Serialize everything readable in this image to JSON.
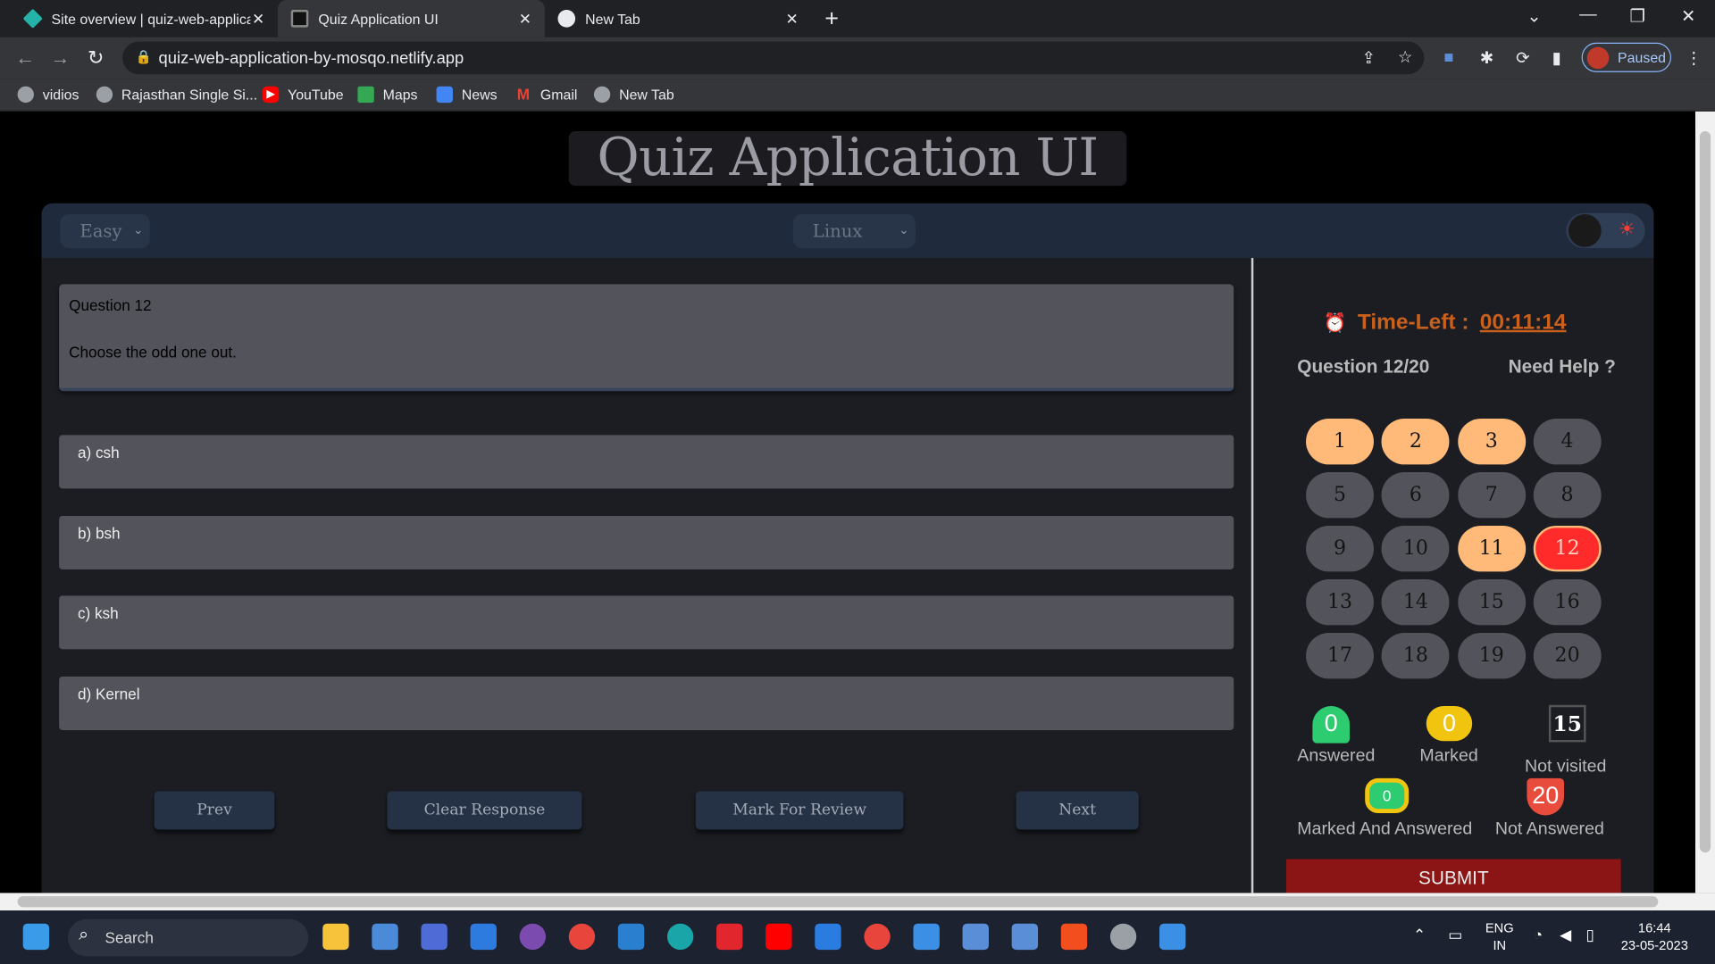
{
  "browser": {
    "tabs": [
      {
        "title": "Site overview | quiz-web-applicat",
        "active": false
      },
      {
        "title": "Quiz Application UI",
        "active": true
      },
      {
        "title": "New Tab",
        "active": false
      }
    ],
    "url": "quiz-web-application-by-mosqo.netlify.app",
    "profile_status": "Paused",
    "bookmarks": [
      "vidios",
      "Rajasthan Single Si...",
      "YouTube",
      "Maps",
      "News",
      "Gmail",
      "New Tab"
    ]
  },
  "quiz": {
    "title": "Quiz Application UI",
    "difficulty": "Easy",
    "category": "Linux",
    "question_label": "Question 12",
    "question_text": "Choose the odd one out.",
    "options": [
      "a) csh",
      "b) bsh",
      "c) ksh",
      "d) Kernel"
    ],
    "buttons": {
      "prev": "Prev",
      "clear": "Clear Response",
      "mark": "Mark For Review",
      "next": "Next"
    }
  },
  "sidebar": {
    "time_left_label": "Time-Left :",
    "time_left_value": "00:11:14",
    "question_progress": "Question 12/20",
    "help_label": "Need Help ?",
    "question_numbers": [
      "1",
      "2",
      "3",
      "4",
      "5",
      "6",
      "7",
      "8",
      "9",
      "10",
      "11",
      "12",
      "13",
      "14",
      "15",
      "16",
      "17",
      "18",
      "19",
      "20"
    ],
    "visited_questions": [
      1,
      2,
      3,
      11
    ],
    "current_question": 12,
    "stats": {
      "answered": "0",
      "answered_label": "Answered",
      "marked": "0",
      "marked_label": "Marked",
      "not_visited": "15",
      "not_visited_label": "Not visited",
      "marked_answered": "0",
      "marked_answered_label": "Marked And Answered",
      "not_answered": "20",
      "not_answered_label": "Not Answered"
    },
    "submit_label": "SUBMIT"
  },
  "taskbar": {
    "search_label": "Search",
    "lang_top": "ENG",
    "lang_bottom": "IN",
    "time": "16:44",
    "date": "23-05-2023"
  },
  "colors": {
    "visited": "#ffba7a",
    "current": "#ff2b2b",
    "answered": "#2ecc71",
    "marked": "#f1c40f",
    "submit": "#8b1515",
    "timer": "#c9601c"
  }
}
